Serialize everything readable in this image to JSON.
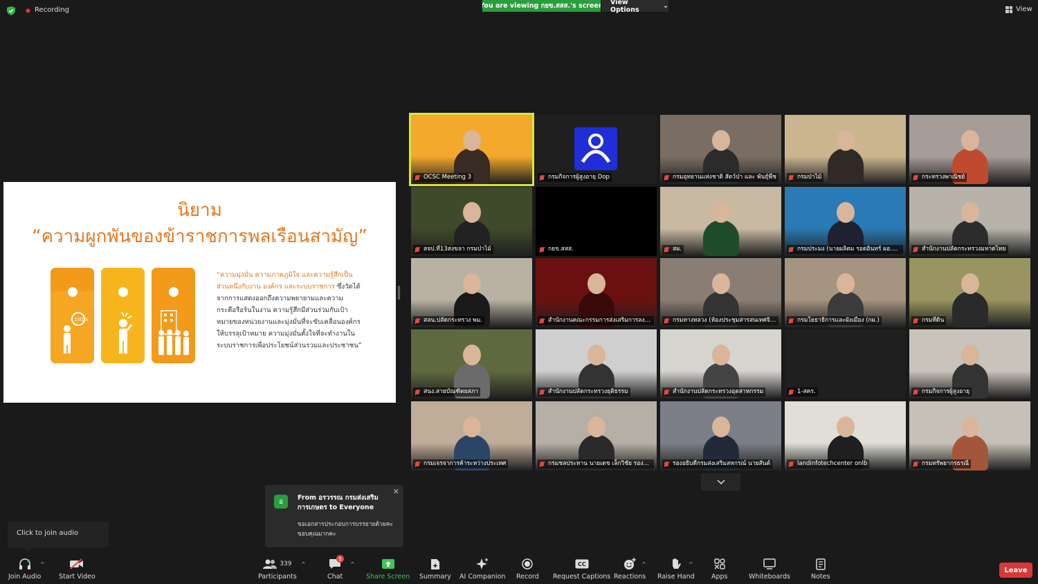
{
  "topbar": {
    "recording_label": "Recording",
    "viewing_banner": "You are viewing กยข.สสส.'s screen",
    "view_options_label": "View Options",
    "view_label": "View"
  },
  "slide": {
    "title": "นิยาม",
    "subtitle": "“ความผูกพันของข้าราชการพลเรือนสามัญ”",
    "quote_highlight": "“ความมุ่งมั่น ความภาคภูมิใจ และความรู้สึกเป็นส่วนหนึ่งกับงาน องค์กร และระบบราชการ",
    "quote_body": "ซึ่งวัดได้จากการแสดงออกถึงความพยายามและความกระตือรือร้นในงาน ความรู้สึกมีส่วนร่วมกับเป้าหมายของหน่วยงานและมุ่งมั่นที่จะขับเคลื่อนองค์กรให้บรรลุเป้าหมาย ความมุ่งมั่นตั้งใจที่จะทำงานในระบบราชการเพื่อประโยชน์ส่วนรวมและประชาชน”",
    "card_colors": [
      "#f5a623",
      "#f7b51d",
      "#f39a1b"
    ]
  },
  "gallery": [
    {
      "name": "OCSC Meeting 3",
      "bg": "#f4a82c",
      "skin": "#3a2a24",
      "active": true
    },
    {
      "name": "กรมกิจการผู้สูงอายุ Dop",
      "bg": "#1f1f1f",
      "logo": true
    },
    {
      "name": "กรมอุทยานแห่งชาติ สัตว์ป่า และ พันธุ์พืช",
      "bg": "#7a6e64",
      "skin": "#2b2b2b"
    },
    {
      "name": "กรมป่าไม้",
      "bg": "#cbb58f",
      "skin": "#2f2a26"
    },
    {
      "name": "กระทรวงพาณิชย์",
      "bg": "#a79d98",
      "skin": "#c04a30"
    },
    {
      "name": "สจป.ที่13สงขลา กรมป่าไม้",
      "bg": "#3f4a2a",
      "skin": "#222"
    },
    {
      "name": "กยข.สสส.",
      "bg": "#000000"
    },
    {
      "name": "สผ.",
      "bg": "#c8b9a2",
      "skin": "#1f4b2d"
    },
    {
      "name": "กรมประมง (นายผลิตม รอดอินทร์ ผอ.กอ.)",
      "bg": "#2a7ab6",
      "skin": "#1e2230"
    },
    {
      "name": "สำนักงานปลัดกระทรวงมหาดไทย",
      "bg": "#b7b3ab",
      "skin": "#2c2c2c"
    },
    {
      "name": "สลน.ปลัดกระทรวง พม.",
      "bg": "#b9b2a4",
      "skin": "#1a1a1a"
    },
    {
      "name": "สำนักงานคณะกรรมการส่งเสริมการลงทุน",
      "bg": "#6b1010",
      "skin": "#3a0a0a"
    },
    {
      "name": "กรมทางหลวง (ห้องประชุมสารสนเทศจิตร)",
      "bg": "#8a7e74",
      "skin": "#333"
    },
    {
      "name": "กรมโยธาธิการและผังเมือง (กผ.)",
      "bg": "#a59480",
      "skin": "#3b3b3b"
    },
    {
      "name": "กรมที่ดิน",
      "bg": "#9a9560",
      "skin": "#2a2a2a"
    },
    {
      "name": "สนง.สายบัณฑิตยสภา",
      "bg": "#5e6a3e",
      "skin": "#6b6b6b"
    },
    {
      "name": "สำนักงานปลัดกระทรวงยุติธรรม",
      "bg": "#cfcfcf",
      "skin": "#333"
    },
    {
      "name": "สำนักงานปลัดกระทรวงอุตสาหกรรม",
      "bg": "#d6d4cf",
      "skin": "#444"
    },
    {
      "name": "1-สคร.",
      "bg": "#1f1f1f"
    },
    {
      "name": "กรมกิจการผู้สูงอายุ",
      "bg": "#c9c3bb",
      "skin": "#333"
    },
    {
      "name": "กรมเจรจาการค้าระหว่างประเทศ",
      "bg": "#c0ad98",
      "skin": "#2b4566"
    },
    {
      "name": "กรมชลประทาน นายเดช เล็กวิชัย รองอธิบดี",
      "bg": "#b5afa6",
      "skin": "#2a2a2a"
    },
    {
      "name": "รองอธิบดีกรมส่งเสริมสหกรณ์ นายสันต์",
      "bg": "#7c7f88",
      "skin": "#222a3a"
    },
    {
      "name": "landinfotechcenter onlb",
      "bg": "#e0ded6",
      "skin": "#1f1f1f"
    },
    {
      "name": "กรมทรัพยากรธรณี",
      "bg": "#c6c1b8",
      "skin": "#a3563b"
    }
  ],
  "chat_toast": {
    "avatar_letter": "อ",
    "from_text": "From อรวรรณ กรมส่งเสริมการเกษตร to Everyone",
    "message": "ขอเอกสารประกอบการบรรยายด้วยคะ ขอบคุณมากคะ",
    "close_glyph": "✕"
  },
  "audio_toast": "Click to join audio",
  "toolbar": {
    "join_audio": "Join Audio",
    "start_video": "Start Video",
    "participants": "Participants",
    "participants_count": "339",
    "chat": "Chat",
    "chat_badge": "5",
    "share_screen": "Share Screen",
    "summary": "Summary",
    "ai_companion": "AI Companion",
    "record": "Record",
    "request_captions": "Request Captions",
    "reactions": "Reactions",
    "raise_hand": "Raise Hand",
    "apps": "Apps",
    "whiteboards": "Whiteboards",
    "notes": "Notes",
    "leave": "Leave",
    "caret": "^"
  },
  "colors": {
    "accent_green": "#2a9e3e",
    "leave_red": "#d93838",
    "slide_orange": "#e8761d"
  }
}
